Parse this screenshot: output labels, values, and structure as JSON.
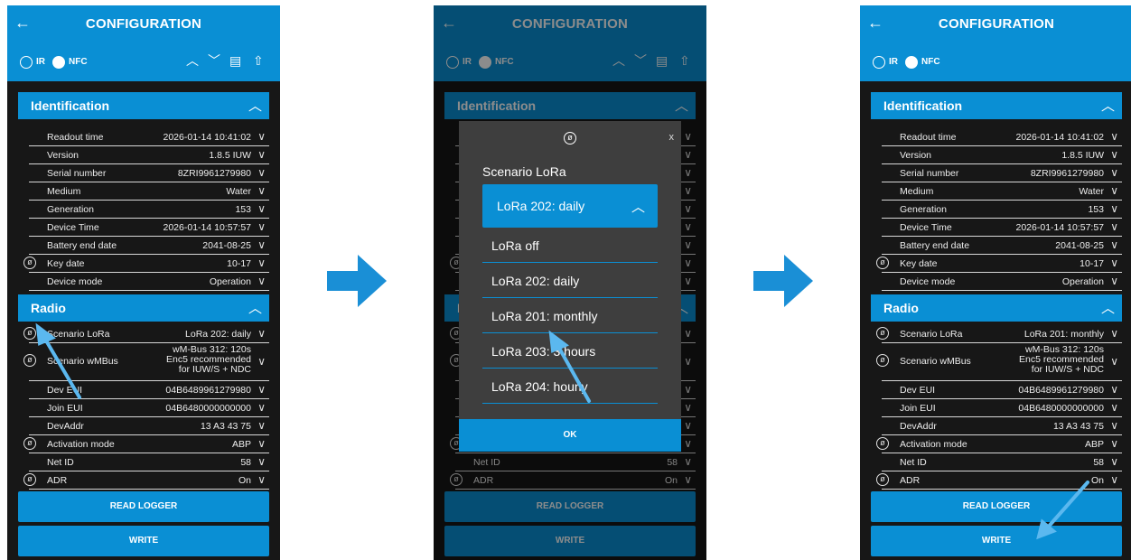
{
  "header": {
    "title": "CONFIGURATION",
    "back_icon": "arrow-left-icon"
  },
  "mode": {
    "ir_label": "IR",
    "nfc_label": "NFC"
  },
  "toolbar_icons": [
    "chevron-up-icon",
    "chevron-down-icon",
    "document-icon",
    "upload-icon"
  ],
  "sections": {
    "identification": "Identification",
    "radio": "Radio"
  },
  "identification_rows": [
    {
      "label": "Readout time",
      "value": "2026-01-14 10:41:02"
    },
    {
      "label": "Version",
      "value": "1.8.5 IUW"
    },
    {
      "label": "Serial number",
      "value": "8ZRI9961279980"
    },
    {
      "label": "Medium",
      "value": "Water"
    },
    {
      "label": "Generation",
      "value": "153"
    },
    {
      "label": "Device Time",
      "value": "2026-01-14 10:57:57"
    },
    {
      "label": "Battery end date",
      "value": "2041-08-25"
    },
    {
      "label": "Key date",
      "value": "10-17"
    },
    {
      "label": "Device mode",
      "value": "Operation"
    }
  ],
  "radio_rows": [
    {
      "label": "Scenario LoRa",
      "value": "LoRa 202: daily"
    },
    {
      "label": "Scenario wMBus",
      "value_lines": [
        "wM-Bus 312: 120s",
        "Enc5 recommended",
        "for IUW/S + NDC"
      ]
    },
    {
      "label": "Dev EUI",
      "value": "04B6489961279980"
    },
    {
      "label": "Join EUI",
      "value": "04B6480000000000"
    },
    {
      "label": "DevAddr",
      "value": "13 A3 43 75"
    },
    {
      "label": "Activation mode",
      "value": "ABP"
    },
    {
      "label": "Net ID",
      "value": "58"
    },
    {
      "label": "ADR",
      "value": "On"
    }
  ],
  "final_scenario_lora": "LoRa 201: monthly",
  "buttons": {
    "read_logger": "READ LOGGER",
    "write": "WRITE"
  },
  "dialog": {
    "label": "Scenario LoRa",
    "selected": "LoRa 202: daily",
    "options": [
      "LoRa off",
      "LoRa 202: daily",
      "LoRa 201: monthly",
      "LoRa 203: 3 hours",
      "LoRa 204: hourly"
    ],
    "ok": "OK",
    "close": "x"
  },
  "colors": {
    "accent": "#0a8fd4",
    "background": "#171717",
    "dialog": "#3e3e3e",
    "arrow": "#1a8fd6"
  }
}
